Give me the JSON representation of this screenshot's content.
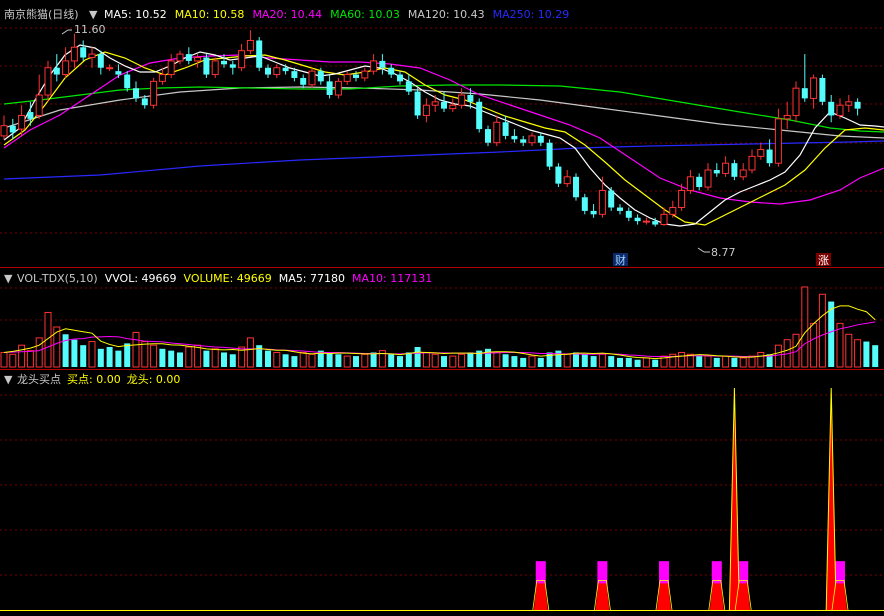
{
  "colors": {
    "background": "#000000",
    "grid": "#7a0000",
    "up": "#ff3232",
    "down": "#54fcfc",
    "ma5": "#ffffff",
    "ma10": "#ffff00",
    "ma20": "#ff00ff",
    "ma60": "#00e600",
    "ma120": "#c8c8c8",
    "ma250": "#2828ff",
    "buy_point": "#ff0000",
    "leader": "#ff00ff"
  },
  "main_panel": {
    "title": "南京熊猫(日线)",
    "indicators": [
      {
        "label": "MA5: 10.52",
        "color": "#ffffff"
      },
      {
        "label": "MA10: 10.58",
        "color": "#ffff00"
      },
      {
        "label": "MA20: 10.44",
        "color": "#ff00ff"
      },
      {
        "label": "MA60: 10.03",
        "color": "#00e600"
      },
      {
        "label": "MA120: 10.43",
        "color": "#c8c8c8"
      },
      {
        "label": "MA250: 10.29",
        "color": "#2828ff"
      }
    ],
    "high_marker": "11.60",
    "low_marker": "8.77",
    "tag_cai": "财",
    "tag_zhang": "涨"
  },
  "vol_panel": {
    "indicators": [
      {
        "label": "VOL-TDX(5,10)",
        "color": "#c8c8c8"
      },
      {
        "label": "VVOL: 49669",
        "color": "#ffffff"
      },
      {
        "label": "VOLUME: 49669",
        "color": "#ffff00"
      },
      {
        "label": "MA5: 77180",
        "color": "#ffffff"
      },
      {
        "label": "MA10: 117131",
        "color": "#ff00ff"
      }
    ]
  },
  "ind_panel": {
    "indicators": [
      {
        "label": "龙头买点",
        "color": "#c8c8c8"
      },
      {
        "label": "买点: 0.00",
        "color": "#ffff00"
      },
      {
        "label": "龙头: 0.00",
        "color": "#ffff00"
      }
    ]
  },
  "chart_data": {
    "type": "candlestick",
    "y_range": [
      8.5,
      11.8
    ],
    "candles": [
      [
        10.1,
        10.25,
        10.4,
        10.05
      ],
      [
        10.25,
        10.15,
        10.35,
        10.05
      ],
      [
        10.2,
        10.4,
        10.55,
        10.1
      ],
      [
        10.45,
        10.35,
        10.6,
        10.25
      ],
      [
        10.4,
        10.7,
        11.0,
        10.35
      ],
      [
        10.7,
        11.1,
        11.2,
        10.6
      ],
      [
        11.1,
        11.0,
        11.3,
        10.9
      ],
      [
        11.0,
        11.2,
        11.4,
        10.95
      ],
      [
        11.2,
        11.4,
        11.6,
        11.1
      ],
      [
        11.4,
        11.25,
        11.5,
        11.2
      ],
      [
        11.25,
        11.3,
        11.4,
        11.1
      ],
      [
        11.3,
        11.1,
        11.35,
        11.0
      ],
      [
        11.1,
        11.1,
        11.15,
        11.05
      ],
      [
        11.05,
        11.0,
        11.15,
        10.95
      ],
      [
        11.0,
        10.8,
        11.05,
        10.75
      ],
      [
        10.8,
        10.65,
        10.9,
        10.6
      ],
      [
        10.65,
        10.55,
        10.7,
        10.5
      ],
      [
        10.55,
        10.9,
        10.95,
        10.5
      ],
      [
        10.9,
        11.0,
        11.1,
        10.85
      ],
      [
        11.0,
        11.2,
        11.3,
        10.95
      ],
      [
        11.2,
        11.3,
        11.35,
        11.15
      ],
      [
        11.3,
        11.2,
        11.4,
        11.15
      ],
      [
        11.2,
        11.25,
        11.3,
        11.1
      ],
      [
        11.25,
        11.0,
        11.3,
        10.95
      ],
      [
        11.0,
        11.2,
        11.25,
        10.95
      ],
      [
        11.2,
        11.15,
        11.3,
        11.1
      ],
      [
        11.15,
        11.1,
        11.2,
        11.0
      ],
      [
        11.1,
        11.35,
        11.45,
        11.05
      ],
      [
        11.35,
        11.5,
        11.65,
        11.3
      ],
      [
        11.5,
        11.1,
        11.55,
        11.05
      ],
      [
        11.1,
        11.0,
        11.15,
        10.95
      ],
      [
        11.0,
        11.1,
        11.15,
        10.95
      ],
      [
        11.1,
        11.05,
        11.15,
        11.0
      ],
      [
        11.05,
        10.95,
        11.1,
        10.9
      ],
      [
        10.95,
        10.85,
        11.0,
        10.8
      ],
      [
        10.85,
        11.05,
        11.1,
        10.8
      ],
      [
        11.05,
        10.9,
        11.1,
        10.85
      ],
      [
        10.9,
        10.7,
        11.0,
        10.65
      ],
      [
        10.7,
        10.9,
        10.95,
        10.65
      ],
      [
        10.9,
        11.0,
        11.05,
        10.85
      ],
      [
        11.0,
        10.95,
        11.05,
        10.9
      ],
      [
        10.95,
        11.05,
        11.1,
        10.9
      ],
      [
        11.05,
        11.2,
        11.3,
        11.0
      ],
      [
        11.2,
        11.1,
        11.3,
        11.0
      ],
      [
        11.1,
        11.0,
        11.15,
        10.95
      ],
      [
        11.0,
        10.9,
        11.05,
        10.85
      ],
      [
        10.9,
        10.75,
        11.0,
        10.7
      ],
      [
        10.75,
        10.4,
        10.8,
        10.35
      ],
      [
        10.4,
        10.55,
        10.65,
        10.3
      ],
      [
        10.55,
        10.6,
        10.7,
        10.45
      ],
      [
        10.6,
        10.5,
        10.75,
        10.45
      ],
      [
        10.5,
        10.55,
        10.65,
        10.45
      ],
      [
        10.55,
        10.7,
        10.8,
        10.5
      ],
      [
        10.7,
        10.6,
        10.8,
        10.5
      ],
      [
        10.6,
        10.2,
        10.65,
        10.15
      ],
      [
        10.2,
        10.0,
        10.25,
        9.95
      ],
      [
        10.0,
        10.3,
        10.4,
        9.95
      ],
      [
        10.3,
        10.1,
        10.4,
        10.05
      ],
      [
        10.1,
        10.05,
        10.2,
        10.0
      ],
      [
        10.05,
        10.0,
        10.1,
        9.95
      ],
      [
        10.0,
        10.1,
        10.15,
        9.95
      ],
      [
        10.1,
        10.0,
        10.15,
        9.95
      ],
      [
        10.0,
        9.65,
        10.05,
        9.6
      ],
      [
        9.65,
        9.4,
        9.7,
        9.35
      ],
      [
        9.4,
        9.5,
        9.6,
        9.35
      ],
      [
        9.5,
        9.2,
        9.55,
        9.15
      ],
      [
        9.2,
        9.0,
        9.25,
        8.95
      ],
      [
        9.0,
        8.95,
        9.1,
        8.9
      ],
      [
        8.95,
        9.3,
        9.5,
        8.9
      ],
      [
        9.3,
        9.05,
        9.35,
        9.0
      ],
      [
        9.05,
        9.0,
        9.1,
        8.95
      ],
      [
        9.0,
        8.9,
        9.05,
        8.85
      ],
      [
        8.9,
        8.85,
        8.95,
        8.8
      ],
      [
        8.85,
        8.85,
        8.9,
        8.8
      ],
      [
        8.85,
        8.8,
        8.9,
        8.77
      ],
      [
        8.8,
        8.95,
        9.05,
        8.78
      ],
      [
        8.95,
        9.05,
        9.15,
        8.9
      ],
      [
        9.05,
        9.3,
        9.4,
        9.0
      ],
      [
        9.3,
        9.5,
        9.6,
        9.25
      ],
      [
        9.5,
        9.35,
        9.55,
        9.3
      ],
      [
        9.35,
        9.6,
        9.7,
        9.3
      ],
      [
        9.6,
        9.55,
        9.7,
        9.5
      ],
      [
        9.55,
        9.7,
        9.8,
        9.5
      ],
      [
        9.7,
        9.5,
        9.75,
        9.45
      ],
      [
        9.5,
        9.6,
        9.7,
        9.45
      ],
      [
        9.6,
        9.8,
        9.9,
        9.55
      ],
      [
        9.8,
        9.9,
        10.0,
        9.75
      ],
      [
        9.9,
        9.7,
        10.05,
        9.65
      ],
      [
        9.7,
        10.35,
        10.5,
        9.65
      ],
      [
        10.35,
        10.4,
        10.6,
        10.2
      ],
      [
        10.4,
        10.8,
        10.9,
        10.3
      ],
      [
        10.8,
        10.65,
        11.3,
        10.6
      ],
      [
        10.65,
        10.95,
        11.0,
        10.5
      ],
      [
        10.95,
        10.6,
        11.0,
        10.55
      ],
      [
        10.6,
        10.4,
        10.7,
        10.3
      ],
      [
        10.4,
        10.55,
        10.65,
        10.35
      ],
      [
        10.55,
        10.6,
        10.7,
        10.45
      ],
      [
        10.6,
        10.5,
        10.65,
        10.4
      ]
    ],
    "volume": [
      [
        40,
        1
      ],
      [
        35,
        1
      ],
      [
        60,
        1
      ],
      [
        45,
        1
      ],
      [
        80,
        1
      ],
      [
        150,
        1
      ],
      [
        110,
        1
      ],
      [
        90,
        0
      ],
      [
        75,
        0
      ],
      [
        60,
        0
      ],
      [
        70,
        1
      ],
      [
        50,
        0
      ],
      [
        55,
        0
      ],
      [
        45,
        0
      ],
      [
        65,
        0
      ],
      [
        95,
        1
      ],
      [
        70,
        1
      ],
      [
        60,
        1
      ],
      [
        50,
        0
      ],
      [
        45,
        0
      ],
      [
        40,
        0
      ],
      [
        55,
        1
      ],
      [
        60,
        1
      ],
      [
        45,
        0
      ],
      [
        50,
        1
      ],
      [
        40,
        0
      ],
      [
        35,
        0
      ],
      [
        55,
        1
      ],
      [
        80,
        1
      ],
      [
        60,
        0
      ],
      [
        45,
        0
      ],
      [
        40,
        1
      ],
      [
        35,
        0
      ],
      [
        30,
        0
      ],
      [
        40,
        1
      ],
      [
        35,
        1
      ],
      [
        45,
        0
      ],
      [
        40,
        0
      ],
      [
        35,
        0
      ],
      [
        30,
        1
      ],
      [
        30,
        0
      ],
      [
        35,
        1
      ],
      [
        40,
        0
      ],
      [
        45,
        1
      ],
      [
        35,
        0
      ],
      [
        30,
        0
      ],
      [
        40,
        0
      ],
      [
        55,
        0
      ],
      [
        40,
        1
      ],
      [
        35,
        1
      ],
      [
        30,
        0
      ],
      [
        30,
        1
      ],
      [
        35,
        1
      ],
      [
        40,
        0
      ],
      [
        45,
        0
      ],
      [
        50,
        0
      ],
      [
        40,
        1
      ],
      [
        35,
        0
      ],
      [
        30,
        0
      ],
      [
        25,
        0
      ],
      [
        30,
        1
      ],
      [
        25,
        0
      ],
      [
        40,
        0
      ],
      [
        45,
        0
      ],
      [
        35,
        1
      ],
      [
        40,
        0
      ],
      [
        35,
        0
      ],
      [
        30,
        0
      ],
      [
        35,
        1
      ],
      [
        30,
        0
      ],
      [
        25,
        0
      ],
      [
        25,
        0
      ],
      [
        20,
        0
      ],
      [
        25,
        1
      ],
      [
        20,
        0
      ],
      [
        30,
        1
      ],
      [
        35,
        1
      ],
      [
        40,
        1
      ],
      [
        35,
        1
      ],
      [
        30,
        0
      ],
      [
        30,
        1
      ],
      [
        25,
        0
      ],
      [
        30,
        1
      ],
      [
        25,
        0
      ],
      [
        25,
        1
      ],
      [
        30,
        1
      ],
      [
        40,
        1
      ],
      [
        35,
        0
      ],
      [
        60,
        1
      ],
      [
        75,
        1
      ],
      [
        90,
        1
      ],
      [
        220,
        1
      ],
      [
        120,
        1
      ],
      [
        200,
        1
      ],
      [
        180,
        0
      ],
      [
        120,
        1
      ],
      [
        90,
        1
      ],
      [
        75,
        1
      ],
      [
        70,
        0
      ],
      [
        60,
        0
      ]
    ],
    "vol_ma5": [
      40,
      43,
      47,
      52,
      60,
      78,
      96,
      105,
      101,
      97,
      93,
      71,
      62,
      56,
      59,
      61,
      63,
      64,
      64,
      61,
      60,
      57,
      54,
      50,
      48,
      47,
      48,
      46,
      48,
      51,
      48,
      46,
      46,
      42,
      38,
      36,
      38,
      37,
      38,
      38,
      37,
      36,
      36,
      37,
      36,
      34,
      37,
      41,
      40,
      39,
      37,
      38,
      38,
      38,
      37,
      41,
      42,
      42,
      41,
      37,
      33,
      30,
      32,
      34,
      35,
      38,
      38,
      37,
      38,
      36,
      33,
      29,
      26,
      25,
      23,
      25,
      28,
      30,
      32,
      34,
      33,
      31,
      30,
      28,
      27,
      27,
      30,
      33,
      39,
      46,
      57,
      94,
      119,
      141,
      159,
      168,
      168,
      159,
      152,
      130
    ],
    "vol_ma10": [
      40,
      41,
      42,
      43,
      45,
      55,
      65,
      73,
      77,
      78,
      82,
      83,
      84,
      83,
      78,
      75,
      71,
      70,
      69,
      66,
      64,
      62,
      59,
      57,
      55,
      54,
      52,
      50,
      50,
      50,
      49,
      47,
      46,
      45,
      44,
      42,
      40,
      40,
      40,
      39,
      38,
      37,
      37,
      37,
      36,
      36,
      37,
      38,
      39,
      39,
      39,
      38,
      38,
      38,
      37,
      38,
      39,
      40,
      40,
      40,
      39,
      37,
      37,
      36,
      36,
      36,
      35,
      35,
      36,
      36,
      35,
      33,
      32,
      30,
      29,
      29,
      29,
      30,
      31,
      31,
      31,
      30,
      30,
      30,
      29,
      29,
      30,
      30,
      33,
      36,
      42,
      64,
      77,
      88,
      97,
      105,
      110,
      116,
      120,
      124
    ],
    "buy_spikes": [
      {
        "day": 61,
        "value": 0.12
      },
      {
        "day": 68,
        "value": 0.12
      },
      {
        "day": 75,
        "value": 0.12
      },
      {
        "day": 81,
        "value": 0.12
      },
      {
        "day": 83,
        "value": 1.0
      },
      {
        "day": 84,
        "value": 0.12
      },
      {
        "day": 94,
        "value": 1.0
      },
      {
        "day": 95,
        "value": 0.12
      }
    ],
    "leader_spikes": [
      {
        "day": 61,
        "value": 0.22
      },
      {
        "day": 68,
        "value": 0.22
      },
      {
        "day": 75,
        "value": 0.22
      },
      {
        "day": 81,
        "value": 0.22
      },
      {
        "day": 84,
        "value": 0.22
      },
      {
        "day": 95,
        "value": 0.22
      }
    ]
  }
}
